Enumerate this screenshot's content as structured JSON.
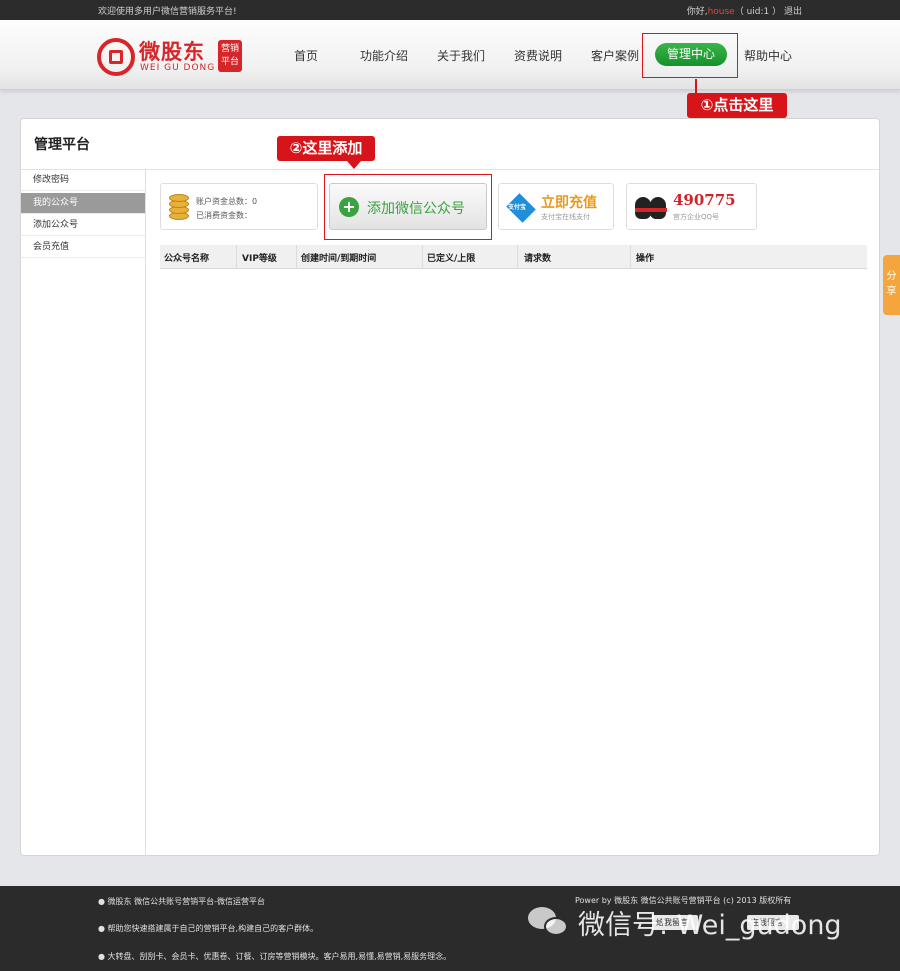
{
  "topbar": {
    "welcome": "欢迎使用多用户微信营销服务平台!",
    "greeting": "你好,",
    "username": "house",
    "uid": "（ uid:1 ）",
    "logout": "退出"
  },
  "logo": {
    "brand": "微股东",
    "sub": "WEI GU DONG",
    "badge_line1": "营销",
    "badge_line2": "平台"
  },
  "nav": {
    "items": [
      "首页",
      "功能介绍",
      "关于我们",
      "资费说明",
      "客户案例",
      "管理中心",
      "帮助中心"
    ]
  },
  "callouts": {
    "step1": "①点击这里",
    "step2": "②这里添加"
  },
  "panel": {
    "title": "管理平台"
  },
  "sidebar": {
    "items": [
      "修改密码",
      "我的公众号",
      "添加公众号",
      "会员充值"
    ]
  },
  "account": {
    "total_label": "账户资金总数：0",
    "spent_label": "已消费资金数："
  },
  "add_button": {
    "label": "添加微信公众号"
  },
  "recharge": {
    "icon_text": "支付宝",
    "title": "立即充值",
    "sub": "支付宝在线支付"
  },
  "qq": {
    "number": "490775",
    "sub": "官方企业QQ号"
  },
  "table": {
    "headers": [
      "公众号名称",
      "VIP等级",
      "创建时间/到期时间",
      "已定义/上限",
      "请求数",
      "操作"
    ]
  },
  "share": {
    "label1": "分",
    "label2": "享"
  },
  "footer": {
    "line1": "● 微股东 微信公共账号营销平台-微信运营平台",
    "line2": "● 帮助您快速搭建属于自己的营销平台,构建自己的客户群体。",
    "line3": "● 大转盘、刮刮卡、会员卡、优惠卷、订餐、订房等营销模块。客户易用,易懂,易营销,易服务理念。",
    "copyright": "Power by 微股东 微信公共账号营销平台 (c) 2013 版权所有",
    "btn1": "给我留言",
    "btn2": "在线留言",
    "watermark": "微信号: Wei_gudong"
  }
}
